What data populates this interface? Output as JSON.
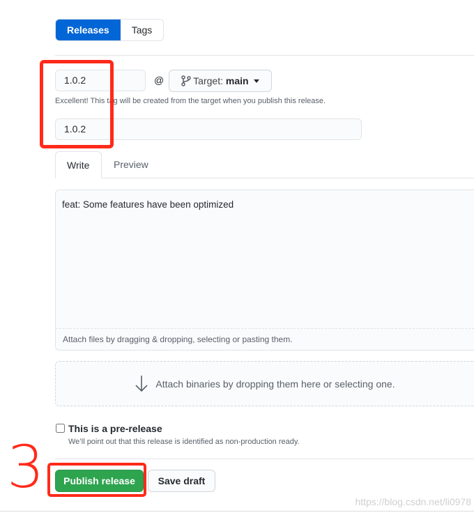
{
  "tabs": {
    "releases": "Releases",
    "tags": "Tags"
  },
  "tag": {
    "value": "1.0.2",
    "at": "@",
    "target_prefix": "Target:",
    "target_branch": "main",
    "hint": "Excellent! This tag will be created from the target when you publish this release."
  },
  "title": {
    "value": "1.0.2"
  },
  "editor": {
    "write": "Write",
    "preview": "Preview",
    "body": "feat: Some features have been optimized",
    "attach": "Attach files by dragging & dropping, selecting or pasting them."
  },
  "binaries": {
    "text": "Attach binaries by dropping them here or selecting one."
  },
  "prerelease": {
    "label": "This is a pre-release",
    "desc": "We’ll point out that this release is identified as non-production ready.",
    "checked": false
  },
  "actions": {
    "publish": "Publish release",
    "draft": "Save draft"
  },
  "annotation": {
    "step": "3",
    "color": "#ff2a1a"
  },
  "watermark": "https://blog.csdn.net/li0978",
  "colors": {
    "primary": "#0366d6",
    "success": "#2ea44f"
  }
}
